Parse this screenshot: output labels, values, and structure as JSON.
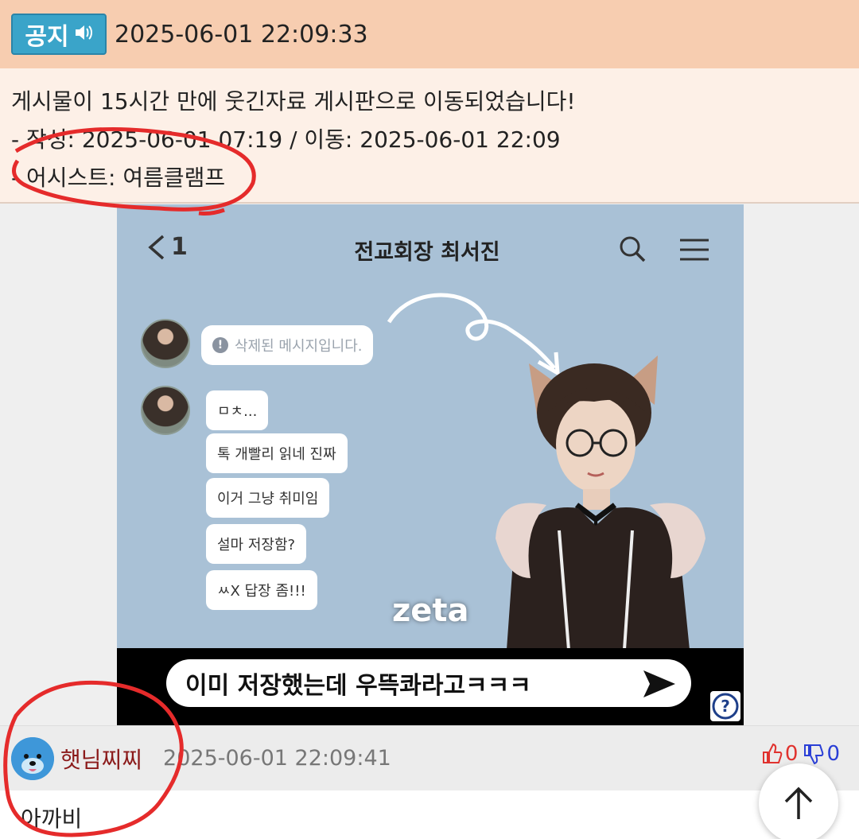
{
  "notice": {
    "badge_label": "공지",
    "timestamp": "2025-06-01 22:09:33",
    "lines": [
      "게시물이 15시간 만에 웃긴자료 게시판으로 이동되었습니다!",
      "- 작성: 2025-06-01 07:19 / 이동: 2025-06-01 22:09",
      "- 어시스트: 여름클램프"
    ]
  },
  "embed": {
    "back_label": "1",
    "chat_title": "전교회장 최서진",
    "deleted_message": "삭제된 메시지입니다.",
    "messages": [
      "ㅁㅊ...",
      "톡 개빨리 읽네 진짜",
      "이거 그냥 취미임",
      "설마 저장함?",
      "ㅆX 답장 좀!!!"
    ],
    "watermark": "zeta",
    "input_text": "이미 저장했는데 우뜩콰라고ㅋㅋㅋ",
    "help_icon": "?"
  },
  "comment": {
    "author": "햇님찌찌",
    "timestamp": "2025-06-01 22:09:41",
    "upvotes": "0",
    "downvotes": "0",
    "text": "아까비"
  },
  "colors": {
    "notice_header_bg": "#f7cdb0",
    "notice_body_bg": "#fdf0e7",
    "badge_bg": "#3aa4c9",
    "author_color": "#8b1a1a",
    "upvote_color": "#e0322e",
    "downvote_color": "#2a3fd6",
    "annotation_color": "#e52b2b"
  },
  "icons": [
    "speaker-icon",
    "back-chevron-icon",
    "search-icon",
    "menu-icon",
    "info-icon",
    "send-icon",
    "help-icon",
    "thumbs-up-icon",
    "thumbs-down-icon",
    "arrow-up-icon"
  ]
}
